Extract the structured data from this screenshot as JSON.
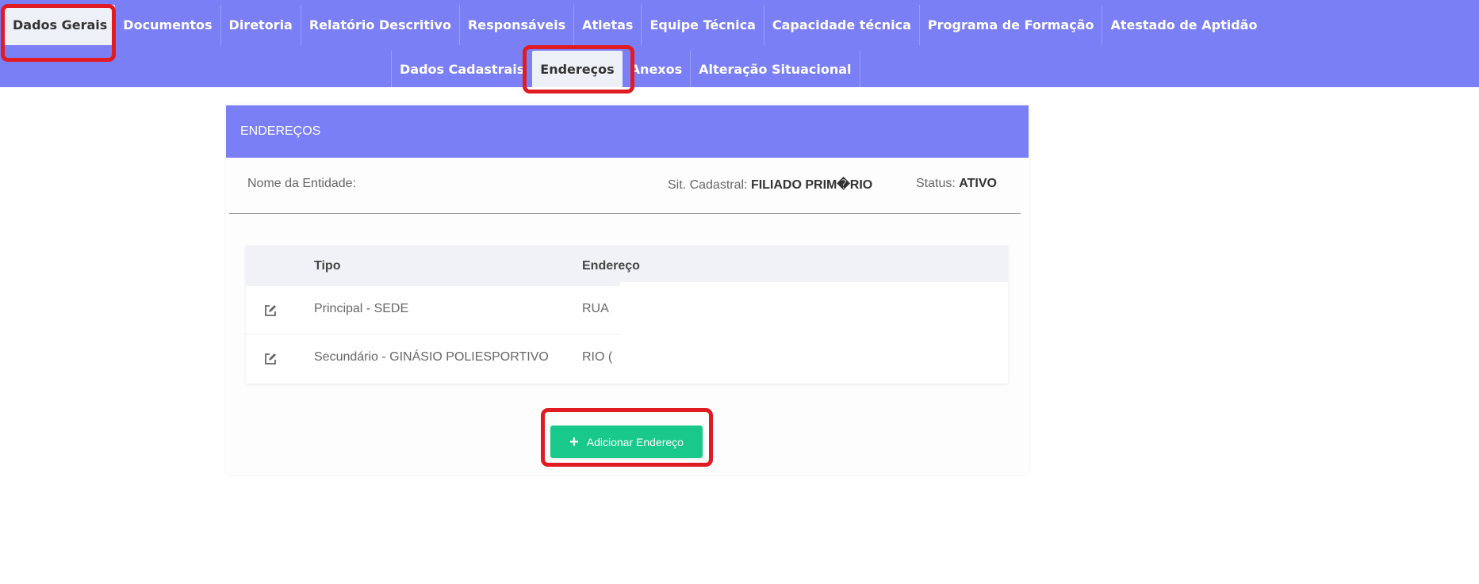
{
  "nav": {
    "row1": [
      {
        "label": "Dados Gerais",
        "active": true
      },
      {
        "label": "Documentos"
      },
      {
        "label": "Diretoria"
      },
      {
        "label": "Relatório Descritivo"
      },
      {
        "label": "Responsáveis"
      },
      {
        "label": "Atletas"
      },
      {
        "label": "Equipe Técnica"
      },
      {
        "label": "Capacidade técnica"
      },
      {
        "label": "Programa de Formação"
      },
      {
        "label": "Atestado de Aptidão"
      }
    ],
    "row2": [
      {
        "label": "Dados Cadastrais"
      },
      {
        "label": "Endereços",
        "active": true
      },
      {
        "label": "Anexos"
      },
      {
        "label": "Alteração Situacional"
      }
    ]
  },
  "card": {
    "title": "ENDEREÇOS",
    "entity_label": "Nome da Entidade:",
    "sit_label": "Sit. Cadastral:",
    "sit_value": "FILIADO PRIM�RIO",
    "status_label": "Status:",
    "status_value": "ATIVO"
  },
  "table": {
    "headers": {
      "tipo": "Tipo",
      "endereco": "Endereço"
    },
    "rows": [
      {
        "tipo": "Principal - SEDE",
        "endereco": "RUA"
      },
      {
        "tipo": "Secundário - GINÁSIO POLIESPORTIVO",
        "endereco": "RIO ("
      }
    ]
  },
  "add_button": {
    "label": "Adicionar Endereço",
    "icon": "plus-icon"
  },
  "colors": {
    "nav_bg": "#7b7ff5",
    "active_tab_bg": "#eef0f8",
    "button_green": "#19c98c",
    "highlight_red": "#e01b22"
  }
}
